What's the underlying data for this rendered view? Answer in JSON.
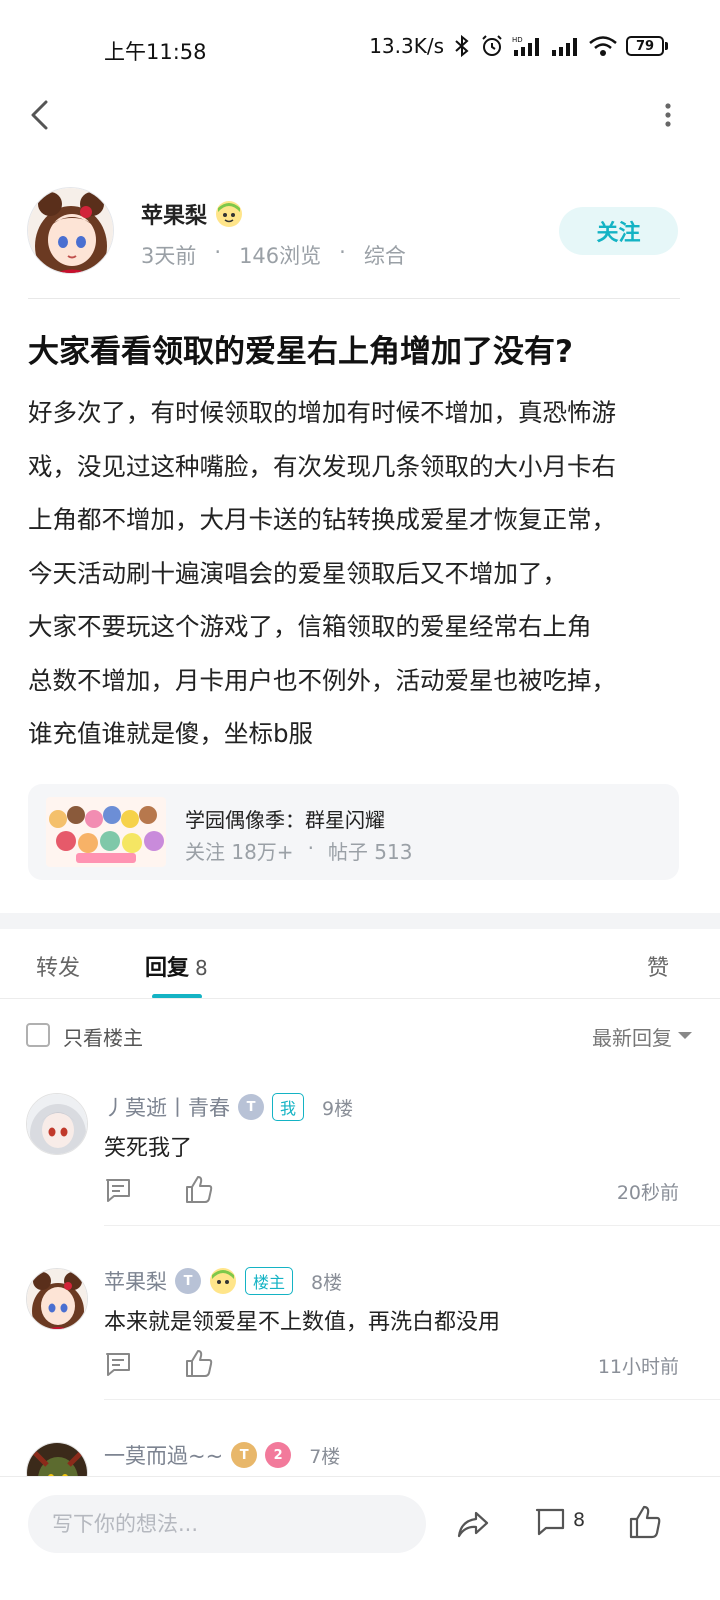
{
  "status": {
    "time": "上午11:58",
    "net_speed": "13.3K/s",
    "battery": "79"
  },
  "author": {
    "name": "苹果梨",
    "time": "3天前",
    "views": "146浏览",
    "category": "综合",
    "follow_label": "关注"
  },
  "post": {
    "title": "大家看看领取的爱星右上角增加了没有?",
    "lines": [
      "好多次了，有时候领取的增加有时候不增加，真恐怖游",
      "戏，没见过这种嘴脸，有次发现几条领取的大小月卡右",
      "上角都不增加，大月卡送的钻转换成爱星才恢复正常，",
      "今天活动刷十遍演唱会的爱星领取后又不增加了，",
      "大家不要玩这个游戏了，信箱领取的爱星经常右上角",
      "总数不增加，月卡用户也不例外，活动爱星也被吃掉，",
      "谁充值谁就是傻，坐标b服"
    ]
  },
  "forum": {
    "name": "学园偶像季：群星闪耀",
    "followers": "关注 18万+",
    "posts": "帖子 513"
  },
  "tabs": {
    "repost": "转发",
    "replies": "回复",
    "replies_count": "8",
    "likes": "赞"
  },
  "filter": {
    "only_op": "只看楼主",
    "sort": "最新回复"
  },
  "comments": [
    {
      "user": "丿莫逝丨青春",
      "level": "T",
      "tag": "我",
      "floor": "9楼",
      "text": "笑死我了",
      "time": "20秒前"
    },
    {
      "user": "苹果梨",
      "level": "T",
      "tag": "楼主",
      "floor": "8楼",
      "text": "本来就是领爱星不上数值，再洗白都没用",
      "time": "11小时前"
    },
    {
      "user": "一莫而過~~",
      "level": "T",
      "badge_number": "2",
      "floor": "7楼"
    }
  ],
  "bottom": {
    "input_placeholder": "写下你的想法...",
    "comment_count": "8"
  },
  "colors": {
    "accent": "#14b3c4",
    "follow_bg": "#e6f7f8",
    "muted_text": "#9aa0a6"
  }
}
